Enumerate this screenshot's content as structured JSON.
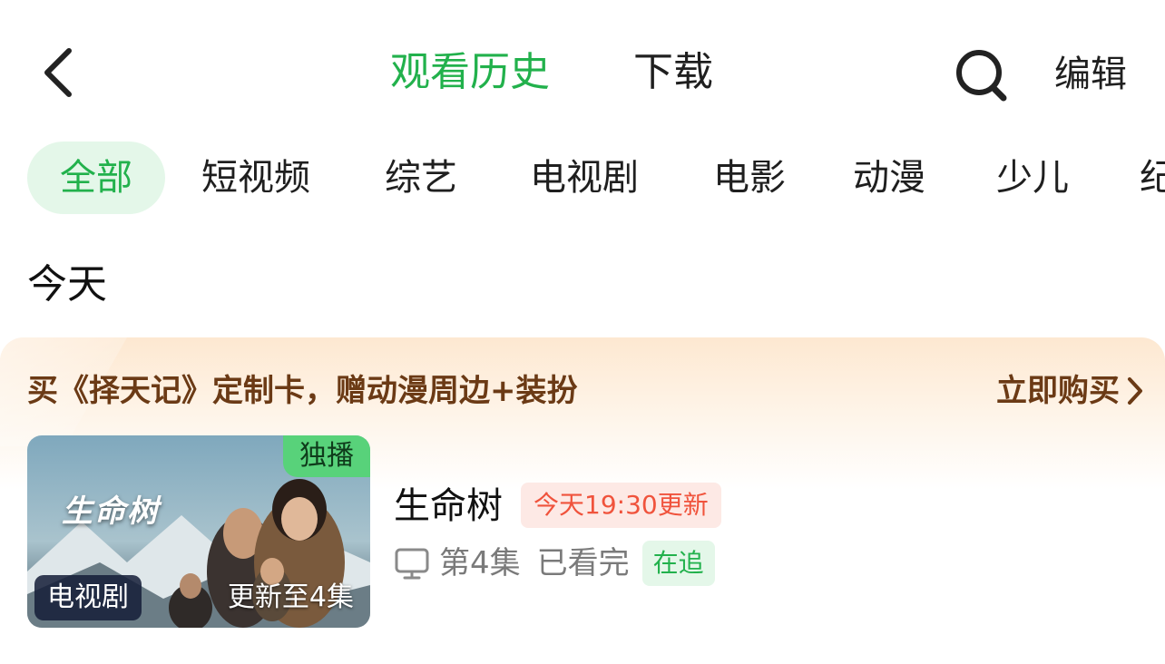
{
  "header": {
    "tabs": [
      {
        "label": "观看历史",
        "active": true
      },
      {
        "label": "下载",
        "active": false
      }
    ],
    "edit_label": "编辑",
    "icons": {
      "back": "chevron-left-icon",
      "search": "search-icon"
    }
  },
  "categories": {
    "items": [
      "全部",
      "短视频",
      "综艺",
      "电视剧",
      "电影",
      "动漫",
      "少儿",
      "纪"
    ],
    "active_index": 0
  },
  "section": {
    "title": "今天"
  },
  "promo": {
    "text": "买《择天记》定制卡，赠动漫周边+装扮",
    "action_label": "立即购买",
    "action_icon": "chevron-right-icon"
  },
  "items": [
    {
      "thumb_title": "生命树",
      "badge_exclusive": "独播",
      "badge_type": "电视剧",
      "badge_progress": "更新至4集",
      "title": "生命树",
      "update_tag": "今天19:30更新",
      "device_icon": "tv-icon",
      "episode": "第4集",
      "watch_status": "已看完",
      "follow_tag": "在追"
    }
  ],
  "colors": {
    "accent": "#22b14c",
    "accent_bg": "#e4f7e9",
    "update_text": "#f0533c",
    "update_bg": "#fde9e5",
    "promo_text": "#6b3a15",
    "promo_bg": "#fde8d1"
  }
}
